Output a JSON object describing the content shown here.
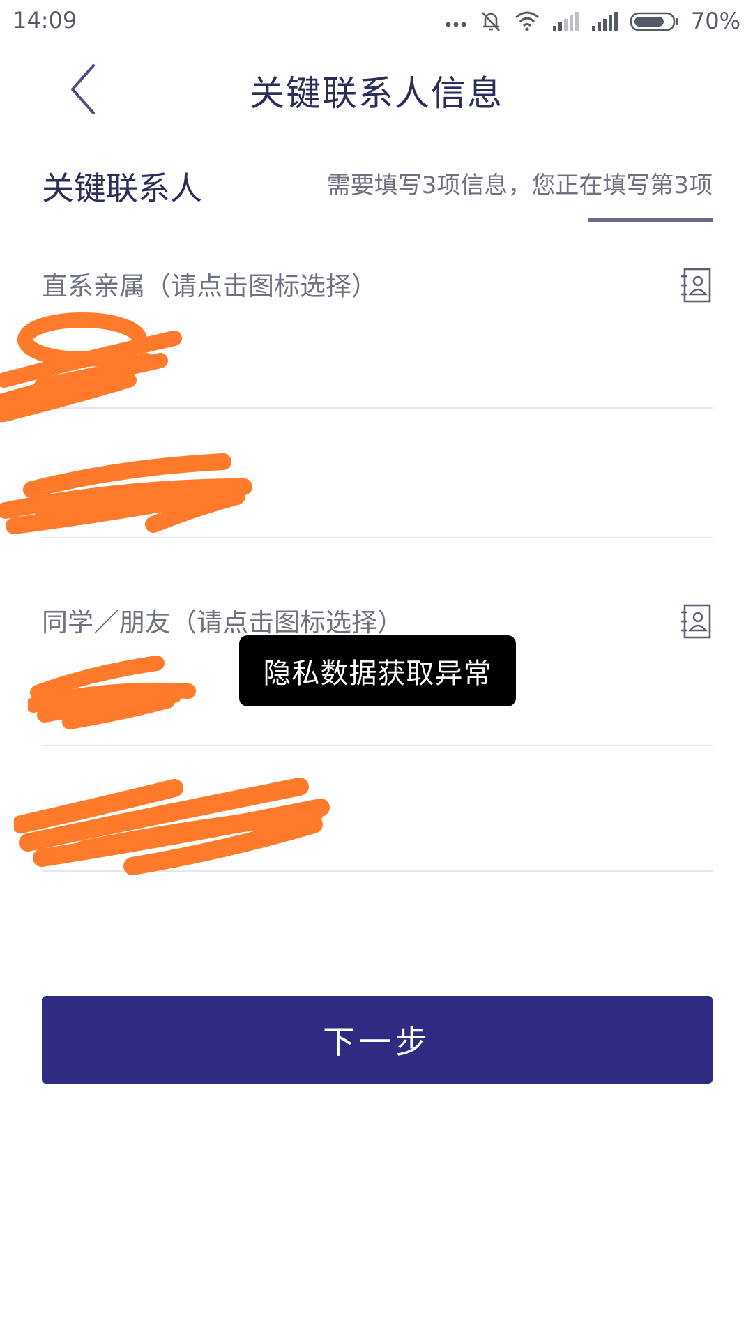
{
  "status_bar": {
    "time": "14:09",
    "battery_text": "70%",
    "icons": [
      "more-dots-icon",
      "silent-bell-icon",
      "wifi-icon",
      "signal-weak-icon",
      "signal-strong-icon",
      "battery-icon"
    ]
  },
  "header": {
    "title": "关键联系人信息",
    "back_icon": "chevron-left-icon"
  },
  "section": {
    "title": "关键联系人",
    "hint": "需要填写3项信息，您正在填写第3项",
    "progress": {
      "current": 3,
      "total": 3
    }
  },
  "groups": [
    {
      "label": "直系亲属（请点击图标选择）",
      "icon": "contact-book-icon",
      "name_value": "",
      "phone_value": ""
    },
    {
      "label": "同学／朋友（请点击图标选择）",
      "icon": "contact-book-icon",
      "name_value": "",
      "phone_value": ""
    }
  ],
  "toast": {
    "text": "隐私数据获取异常"
  },
  "next_button": {
    "label": "下一步"
  },
  "colors": {
    "primary": "#2f2b82",
    "title_text": "#2b2e5a",
    "label_text": "#6f7280",
    "redaction": "#ff7a2b"
  }
}
